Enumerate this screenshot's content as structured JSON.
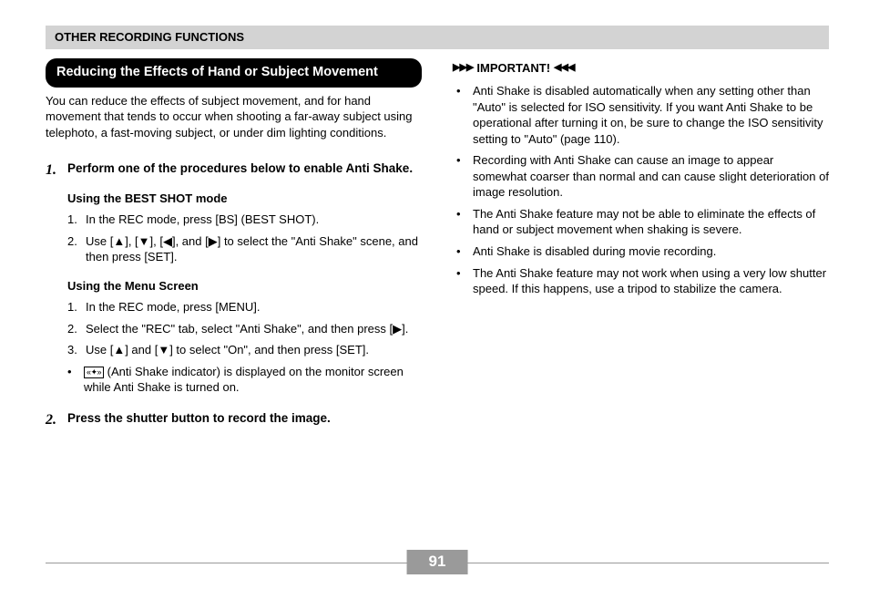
{
  "header": "OTHER RECORDING FUNCTIONS",
  "section_title": "Reducing the Effects of Hand or Subject Movement",
  "intro": "You can reduce the effects of subject movement, and for hand movement that tends to occur when shooting a far-away subject using telephoto, a fast-moving subject, or under dim lighting conditions.",
  "step1": {
    "num": "1.",
    "head": "Perform one of the procedures below to enable Anti Shake.",
    "mode_a_title": "Using the BEST SHOT mode",
    "mode_a_1_num": "1.",
    "mode_a_1_text": "In the REC mode, press [BS] (BEST SHOT).",
    "mode_a_2_num": "2.",
    "mode_a_2_text": "Use [▲], [▼], [◀], and [▶] to select the \"Anti Shake\" scene, and then press [SET].",
    "mode_b_title": "Using the Menu Screen",
    "mode_b_1_num": "1.",
    "mode_b_1_text": "In the REC mode, press [MENU].",
    "mode_b_2_num": "2.",
    "mode_b_2_text": "Select the \"REC\" tab, select \"Anti Shake\", and then press [▶].",
    "mode_b_3_num": "3.",
    "mode_b_3_text": "Use [▲] and [▼] to select \"On\", and then press [SET].",
    "indicator_note": " (Anti Shake indicator) is displayed on the monitor screen while Anti Shake is turned on."
  },
  "step2": {
    "num": "2.",
    "head": "Press the shutter button to record the image."
  },
  "important": {
    "label": "IMPORTANT!",
    "items": [
      "Anti Shake is disabled automatically when any setting other than \"Auto\" is selected for ISO sensitivity. If you want Anti Shake to be operational after turning it on, be sure to change the ISO sensitivity setting to \"Auto\" (page 110).",
      "Recording with Anti Shake can cause an image to appear somewhat coarser than normal and can cause slight deterioration of image resolution.",
      "The Anti Shake feature may not be able to eliminate the effects of hand or subject movement when shaking is severe.",
      "Anti Shake is disabled during movie recording.",
      "The Anti Shake feature may not work when using a very low shutter speed. If this happens, use a tripod to stabilize the camera."
    ]
  },
  "page_number": "91",
  "glyphs": {
    "bullet": "•",
    "indicator": "(泊)",
    "arr_right": "▶▶▶",
    "arr_left": "◀◀◀"
  }
}
